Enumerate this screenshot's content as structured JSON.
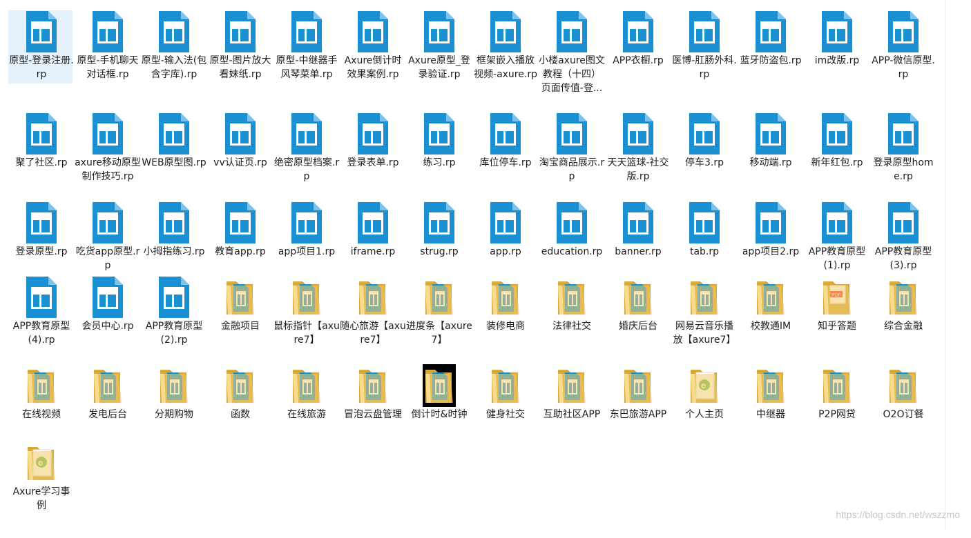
{
  "items": [
    {
      "label": "原型-登录注册.rp",
      "kind": "rp",
      "selected": true
    },
    {
      "label": "原型-手机聊天对话框.rp",
      "kind": "rp"
    },
    {
      "label": "原型-输入法(包含字库).rp",
      "kind": "rp"
    },
    {
      "label": "原型-图片放大看妹纸.rp",
      "kind": "rp"
    },
    {
      "label": "原型-中继器手风琴菜单.rp",
      "kind": "rp"
    },
    {
      "label": "Axure倒计时效果案例.rp",
      "kind": "rp"
    },
    {
      "label": "Axure原型_登录验证.rp",
      "kind": "rp"
    },
    {
      "label": "框架嵌入播放视频-axure.rp",
      "kind": "rp"
    },
    {
      "label": "小楼axure图文教程（十四）页面传值-登...",
      "kind": "rp"
    },
    {
      "label": "APP衣橱.rp",
      "kind": "rp"
    },
    {
      "label": "医博-肛肠外科.rp",
      "kind": "rp"
    },
    {
      "label": "蓝牙防盗包.rp",
      "kind": "rp"
    },
    {
      "label": "im改版.rp",
      "kind": "rp"
    },
    {
      "label": "APP-微信原型.rp",
      "kind": "rp"
    },
    {
      "label": "聚了社区.rp",
      "kind": "rp"
    },
    {
      "label": "axure移动原型制作技巧.rp",
      "kind": "rp"
    },
    {
      "label": "WEB原型图.rp",
      "kind": "rp"
    },
    {
      "label": "vv认证页.rp",
      "kind": "rp"
    },
    {
      "label": "绝密原型档案.rp",
      "kind": "rp"
    },
    {
      "label": "登录表单.rp",
      "kind": "rp"
    },
    {
      "label": "练习.rp",
      "kind": "rp"
    },
    {
      "label": "库位停车.rp",
      "kind": "rp"
    },
    {
      "label": "淘宝商品展示.rp",
      "kind": "rp"
    },
    {
      "label": "天天篮球-社交版.rp",
      "kind": "rp"
    },
    {
      "label": "停车3.rp",
      "kind": "rp"
    },
    {
      "label": "移动端.rp",
      "kind": "rp"
    },
    {
      "label": "新年红包.rp",
      "kind": "rp"
    },
    {
      "label": "登录原型home.rp",
      "kind": "rp"
    },
    {
      "label": "登录原型.rp",
      "kind": "rp"
    },
    {
      "label": "吃货app原型.rp",
      "kind": "rp"
    },
    {
      "label": "小拇指练习.rp",
      "kind": "rp"
    },
    {
      "label": "教育app.rp",
      "kind": "rp"
    },
    {
      "label": "app项目1.rp",
      "kind": "rp"
    },
    {
      "label": "iframe.rp",
      "kind": "rp"
    },
    {
      "label": "strug.rp",
      "kind": "rp"
    },
    {
      "label": "app.rp",
      "kind": "rp"
    },
    {
      "label": "education.rp",
      "kind": "rp"
    },
    {
      "label": "banner.rp",
      "kind": "rp"
    },
    {
      "label": "tab.rp",
      "kind": "rp"
    },
    {
      "label": "app项目2.rp",
      "kind": "rp"
    },
    {
      "label": "APP教育原型 (1).rp",
      "kind": "rp"
    },
    {
      "label": "APP教育原型 (3).rp",
      "kind": "rp"
    },
    {
      "label": "APP教育原型 (4).rp",
      "kind": "rp"
    },
    {
      "label": "会员中心.rp",
      "kind": "rp"
    },
    {
      "label": "APP教育原型 (2).rp",
      "kind": "rp"
    },
    {
      "label": "金融项目",
      "kind": "folder"
    },
    {
      "label": "鼠标指针【axure7】",
      "kind": "folder"
    },
    {
      "label": "随心旅游【axure7】",
      "kind": "folder"
    },
    {
      "label": "进度条【axure7】",
      "kind": "folder"
    },
    {
      "label": "装修电商",
      "kind": "folder"
    },
    {
      "label": "法律社交",
      "kind": "folder"
    },
    {
      "label": "婚庆后台",
      "kind": "folder"
    },
    {
      "label": "网易云音乐播放【axure7】",
      "kind": "folder"
    },
    {
      "label": "校教通IM",
      "kind": "folder"
    },
    {
      "label": "知乎答题",
      "kind": "folder-pdf"
    },
    {
      "label": "综合金融",
      "kind": "folder"
    },
    {
      "label": "在线视频",
      "kind": "folder"
    },
    {
      "label": "发电后台",
      "kind": "folder"
    },
    {
      "label": "分期购物",
      "kind": "folder"
    },
    {
      "label": "函数",
      "kind": "folder"
    },
    {
      "label": "在线旅游",
      "kind": "folder"
    },
    {
      "label": "冒泡云盘管理",
      "kind": "folder"
    },
    {
      "label": "倒计时&时钟",
      "kind": "folder-dark"
    },
    {
      "label": "健身社交",
      "kind": "folder"
    },
    {
      "label": "互助社区APP",
      "kind": "folder"
    },
    {
      "label": "东巴旅游APP",
      "kind": "folder"
    },
    {
      "label": "个人主页",
      "kind": "folder-ie"
    },
    {
      "label": "中继器",
      "kind": "folder"
    },
    {
      "label": "P2P网贷",
      "kind": "folder"
    },
    {
      "label": "O2O订餐",
      "kind": "folder"
    },
    {
      "label": "Axure学习事例",
      "kind": "folder-ie"
    }
  ],
  "watermark": "https://blog.csdn.net/wszzmo",
  "colors": {
    "rp_blue": "#1a8fd1",
    "rp_dark": "#0f6fae",
    "folder": "#f2cc6b",
    "folder_dark": "#d8a83c",
    "selection": "#e5f1fb"
  }
}
